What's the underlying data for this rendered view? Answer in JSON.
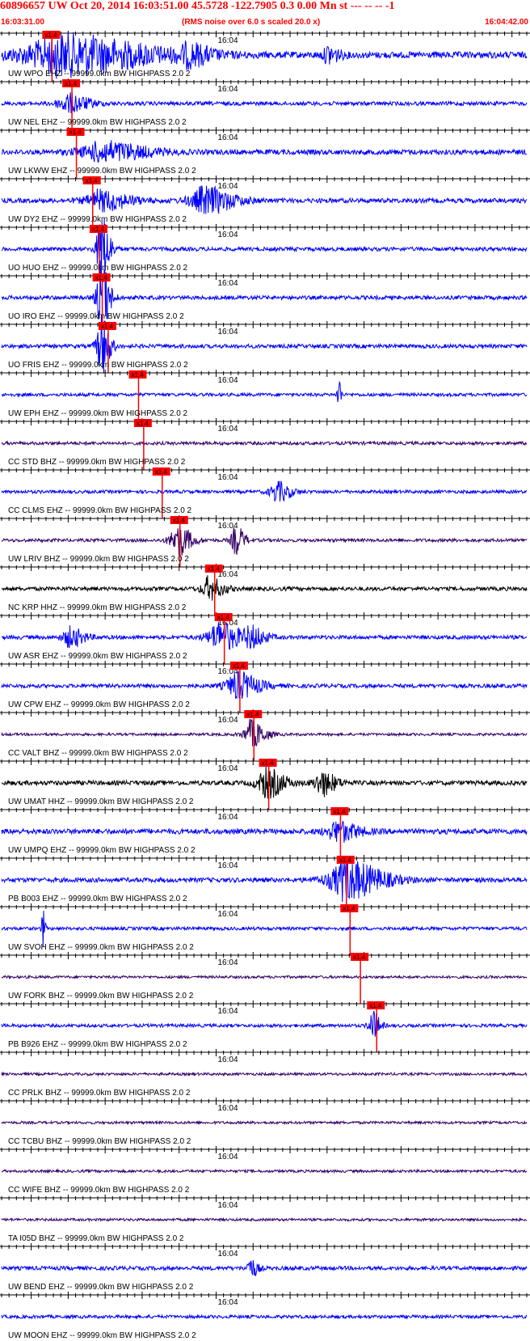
{
  "header": {
    "title": "60896657 UW Oct 20, 2014 16:03:51.00   45.5728 -122.7905  0.3 0.00 Mn st --- -- --   -1",
    "start_time": "16:03:31.00",
    "note": "(RMS noise over 6.0 s scaled 20.0 x)",
    "end_time": "16:04:42.00"
  },
  "colors": {
    "header_text": "#ff0000",
    "pick_box": "#ff0000",
    "pick_line": "#ff0000",
    "trace_blue": "#0000ff",
    "trace_purple": "#330066",
    "trace_black": "#000000"
  },
  "chart_data": {
    "type": "seismogram",
    "time_window": [
      "16:03:31.00",
      "16:04:42.00"
    ],
    "minute_tick_label": "16:04",
    "pick_label": "x1.4",
    "traces": [
      {
        "label": "UW WPO EHZ -- 99999.0km BW  HIGHPASS  2.0  2",
        "color": "blue",
        "pick_s": 5.5,
        "amp": 1.0,
        "bursts": [
          [
            7,
            12,
            3.2
          ],
          [
            25,
            3,
            1.4
          ],
          [
            44,
            1.5,
            1.4
          ]
        ]
      },
      {
        "label": "UW NEL EHZ -- 99999.0km BW  HIGHPASS  2.0  2",
        "color": "blue",
        "pick_s": 8.2,
        "amp": 0.6,
        "bursts": [
          [
            8.6,
            3,
            1.5
          ]
        ]
      },
      {
        "label": "UW LKWW EHZ -- 99999.0km BW  HIGHPASS  2.0  2",
        "color": "blue",
        "pick_s": 8.8,
        "amp": 0.8,
        "bursts": [
          [
            13,
            6,
            1.6
          ]
        ]
      },
      {
        "label": "UW DY2 EHZ -- 99999.0km BW  HIGHPASS  2.0  2",
        "color": "blue",
        "pick_s": 11.0,
        "amp": 0.7,
        "bursts": [
          [
            13,
            4,
            1.6
          ],
          [
            27,
            4,
            2.2
          ]
        ]
      },
      {
        "label": "UO HUO EHZ -- 99999.0km BW  HIGHPASS  2.0  2",
        "color": "blue",
        "pick_s": 11.9,
        "amp": 0.6,
        "bursts": [
          [
            13.3,
            1.2,
            6.0
          ]
        ]
      },
      {
        "label": "UO IRO EHZ -- 99999.0km BW  HIGHPASS  2.0  2",
        "color": "blue",
        "pick_s": 12.3,
        "amp": 0.6,
        "bursts": [
          [
            13.3,
            1.2,
            6.0
          ]
        ]
      },
      {
        "label": "UO FRIS EHZ -- 99999.0km BW  HIGHPASS  2.0  2",
        "color": "blue",
        "pick_s": 13.1,
        "amp": 0.6,
        "bursts": [
          [
            13.3,
            1.2,
            5.0
          ]
        ]
      },
      {
        "label": "UW EPH EHZ -- 99999.0km BW  HIGHPASS  2.0  2",
        "color": "blue",
        "pick_s": 17.2,
        "amp": 0.5,
        "bursts": [
          [
            45.5,
            0.3,
            4.0
          ]
        ]
      },
      {
        "label": "CC STD BHZ -- 99999.0km BW  HIGHPASS  2.0  2",
        "color": "purple",
        "pick_s": 17.9,
        "amp": 0.5,
        "bursts": []
      },
      {
        "label": "CC CLMS EHZ -- 99999.0km BW  HIGHPASS  2.0  2",
        "color": "blue",
        "pick_s": 20.4,
        "amp": 0.5,
        "bursts": [
          [
            37,
            2,
            1.6
          ]
        ]
      },
      {
        "label": "UW LRIV BHZ -- 99999.0km BW  HIGHPASS  2.0  2",
        "color": "purple",
        "pick_s": 22.8,
        "amp": 0.5,
        "bursts": [
          [
            23.5,
            2,
            2.6
          ],
          [
            31.5,
            1.2,
            2.4
          ]
        ]
      },
      {
        "label": "NC KRP HHZ -- 99999.0km BW  HIGHPASS  2.0  2",
        "color": "black",
        "pick_s": 27.5,
        "amp": 0.6,
        "bursts": [
          [
            27.8,
            2,
            1.8
          ]
        ]
      },
      {
        "label": "UW ASR EHZ -- 99999.0km BW  HIGHPASS  2.0  2",
        "color": "blue",
        "pick_s": 28.8,
        "amp": 0.6,
        "bursts": [
          [
            9,
            2,
            1.6
          ],
          [
            29,
            3,
            2.4
          ],
          [
            33.5,
            2,
            1.6
          ]
        ]
      },
      {
        "label": "UW CPW EHZ -- 99999.0km BW  HIGHPASS  2.0  2",
        "color": "blue",
        "pick_s": 30.9,
        "amp": 0.6,
        "bursts": [
          [
            31.5,
            3,
            2.2
          ]
        ]
      },
      {
        "label": "CC VALT BHZ -- 99999.0km BW  HIGHPASS  2.0  2",
        "color": "purple",
        "pick_s": 32.8,
        "amp": 0.4,
        "bursts": [
          [
            33.5,
            2,
            2.2
          ]
        ]
      },
      {
        "label": "UW UMAT HHZ -- 99999.0km BW  HIGHPASS  2.0  2",
        "color": "black",
        "pick_s": 34.8,
        "amp": 0.7,
        "bursts": [
          [
            35.5,
            2.5,
            2.4
          ],
          [
            43,
            2,
            2.0
          ]
        ]
      },
      {
        "label": "UW UMPQ EHZ -- 99999.0km BW  HIGHPASS  2.0  2",
        "color": "blue",
        "pick_s": 44.5,
        "amp": 0.8,
        "bursts": [
          [
            45,
            3,
            1.6
          ]
        ]
      },
      {
        "label": "PB B003 EHZ -- 99999.0km BW  HIGHPASS  2.0  2",
        "color": "blue",
        "pick_s": 45.3,
        "amp": 0.7,
        "bursts": [
          [
            46,
            5,
            3.2
          ]
        ]
      },
      {
        "label": "UW SVOH EHZ -- 99999.0km BW  HIGHPASS  2.0  2",
        "color": "blue",
        "pick_s": 45.8,
        "amp": 0.5,
        "bursts": [
          [
            5.5,
            0.3,
            3.5
          ]
        ]
      },
      {
        "label": "UW FORK BHZ -- 99999.0km BW  HIGHPASS  2.0  2",
        "color": "purple",
        "pick_s": 47.2,
        "amp": 0.4,
        "bursts": []
      },
      {
        "label": "PB B926 EHZ -- 99999.0km BW  HIGHPASS  2.0  2",
        "color": "blue",
        "pick_s": 49.4,
        "amp": 0.5,
        "bursts": [
          [
            50,
            1,
            2.4
          ]
        ]
      },
      {
        "label": "CC PRLK BHZ -- 99999.0km BW  HIGHPASS  2.0  2",
        "color": "purple",
        "pick_s": null,
        "amp": 0.4,
        "bursts": []
      },
      {
        "label": "CC TCBU BHZ -- 99999.0km BW  HIGHPASS  2.0  2",
        "color": "purple",
        "pick_s": null,
        "amp": 0.4,
        "bursts": []
      },
      {
        "label": "CC WIFE BHZ -- 99999.0km BW  HIGHPASS  2.0  2",
        "color": "purple",
        "pick_s": null,
        "amp": 0.4,
        "bursts": []
      },
      {
        "label": "TA I05D BHZ -- 99999.0km BW  HIGHPASS  2.0  2",
        "color": "purple",
        "pick_s": null,
        "amp": 0.4,
        "bursts": []
      },
      {
        "label": "UW BEND EHZ -- 99999.0km BW  HIGHPASS  2.0  2",
        "color": "blue",
        "pick_s": null,
        "amp": 0.6,
        "bursts": [
          [
            33.5,
            1,
            1.6
          ]
        ]
      },
      {
        "label": "UW MOON EHZ -- 99999.0km BW  HIGHPASS  2.0  2",
        "color": "blue",
        "pick_s": null,
        "amp": 0.5,
        "bursts": []
      }
    ]
  }
}
